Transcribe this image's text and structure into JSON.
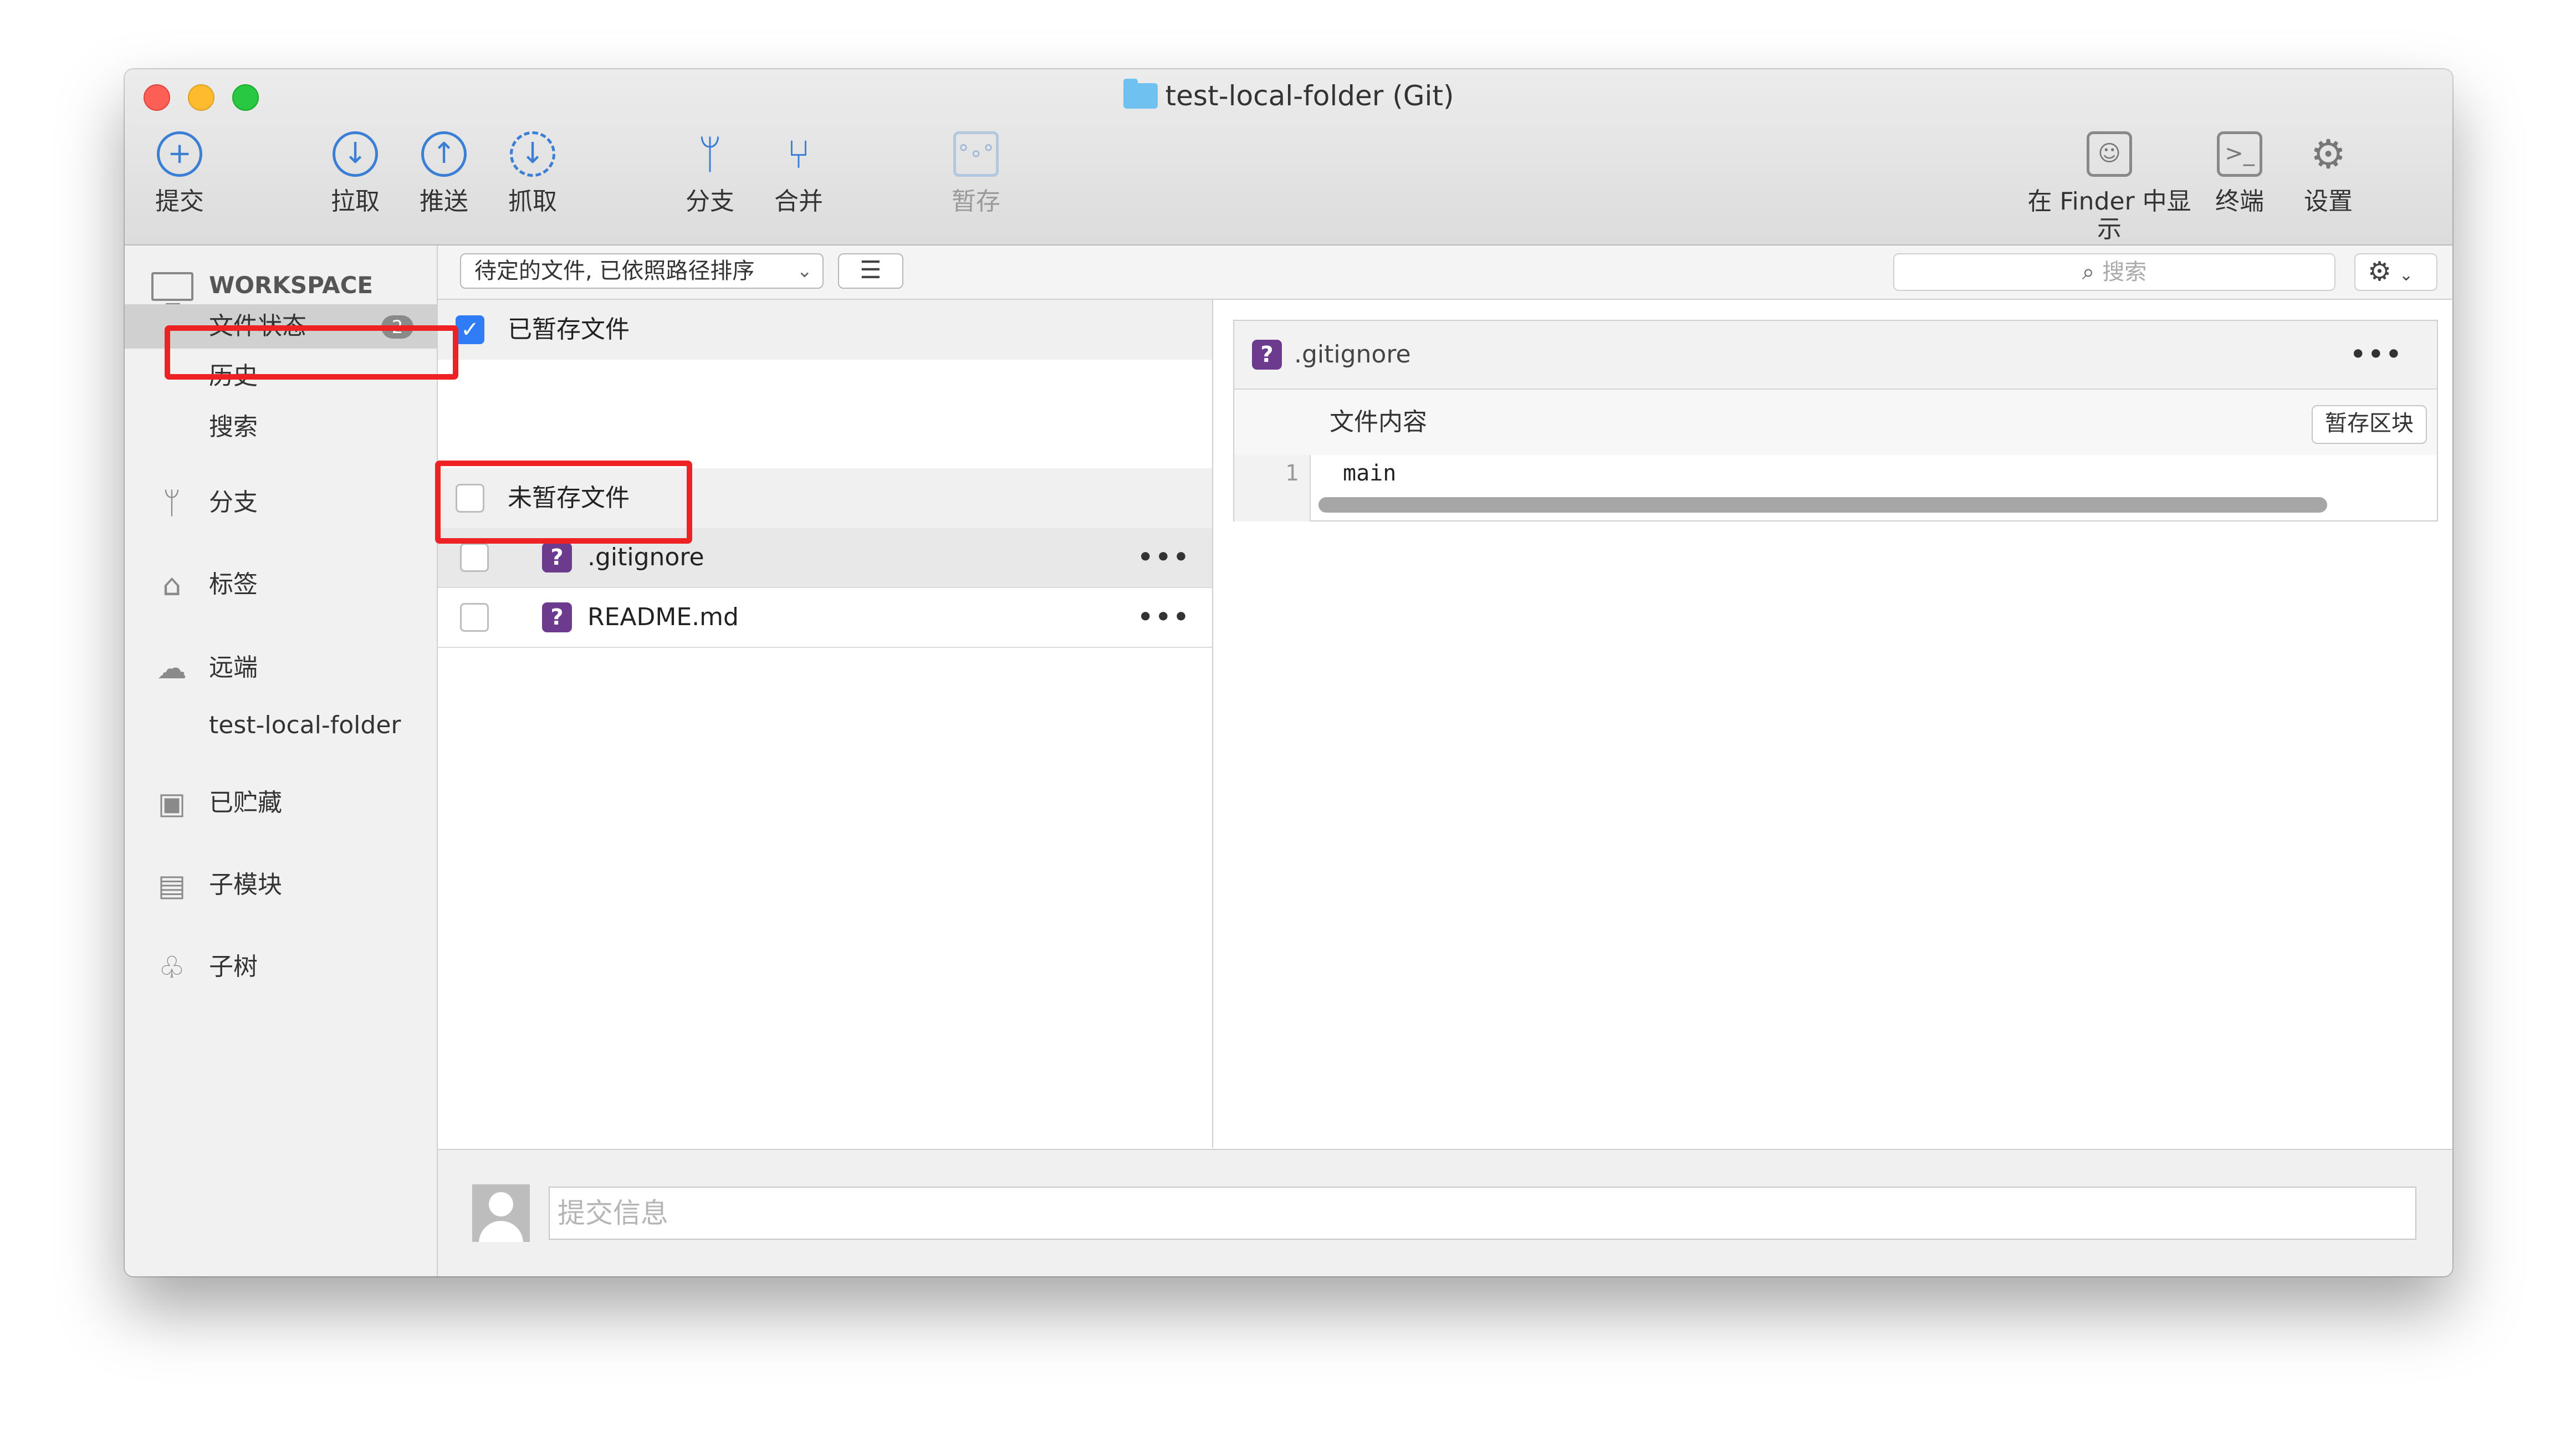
{
  "window": {
    "title": "test-local-folder (Git)"
  },
  "toolbar": {
    "commit": "提交",
    "pull": "拉取",
    "push": "推送",
    "fetch": "抓取",
    "branch": "分支",
    "merge": "合并",
    "stash": "暂存",
    "show_in_finder": "在 Finder 中显示",
    "terminal": "终端",
    "settings": "设置"
  },
  "sidebar": {
    "workspace": "WORKSPACE",
    "file_status": "文件状态",
    "file_status_count": "2",
    "history": "历史",
    "search": "搜索",
    "branches": "分支",
    "tags": "标签",
    "remotes": "远端",
    "remote_item": "test-local-folder",
    "stashes": "已贮藏",
    "submodules": "子模块",
    "subtrees": "子树"
  },
  "filter": {
    "sort": "待定的文件, 已依照路径排序",
    "search_placeholder": "搜索"
  },
  "staged": {
    "label": "已暂存文件",
    "checked": true
  },
  "unstaged": {
    "label": "未暂存文件",
    "files": [
      {
        "name": ".gitignore",
        "status": "?"
      },
      {
        "name": "README.md",
        "status": "?"
      }
    ]
  },
  "diff": {
    "file": ".gitignore",
    "hunk_label": "文件内容",
    "stage_hunk": "暂存区块",
    "lines": [
      {
        "num": "1",
        "text": "main"
      }
    ]
  },
  "commit": {
    "placeholder": "提交信息"
  },
  "colors": {
    "accent": "#3a7fd5",
    "annotation": "#ee2222",
    "untracked": "#6d3b8e"
  }
}
